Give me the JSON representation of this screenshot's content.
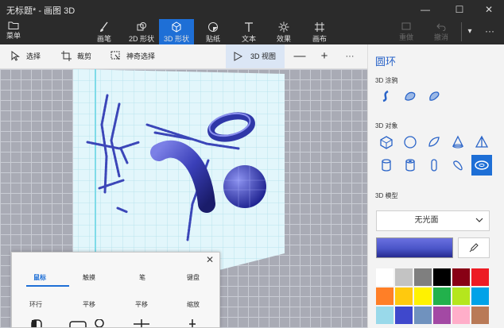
{
  "window": {
    "title": "无标题* - 画图 3D",
    "minimize_glyph": "—",
    "maximize_glyph": "☐",
    "close_glyph": "✕"
  },
  "ribbon": {
    "menu_label": "菜单",
    "tools": [
      {
        "label": "画笔",
        "icon": "brush-icon",
        "active": false
      },
      {
        "label": "2D 形状",
        "icon": "2d-shapes-icon",
        "active": false
      },
      {
        "label": "3D 形状",
        "icon": "3d-shapes-icon",
        "active": true
      },
      {
        "label": "贴纸",
        "icon": "sticker-icon",
        "active": false
      },
      {
        "label": "文本",
        "icon": "text-icon",
        "active": false
      },
      {
        "label": "效果",
        "icon": "effects-icon",
        "active": false
      },
      {
        "label": "画布",
        "icon": "canvas-icon",
        "active": false
      }
    ],
    "undo_label": "撤消",
    "redo_label": "重做",
    "more_glyph": "▾",
    "dots_glyph": "···"
  },
  "toolbar": {
    "select_label": "选择",
    "crop_label": "裁剪",
    "magic_select_label": "神奇选择",
    "view3d_label": "3D 视图",
    "zoom_out_glyph": "—",
    "zoom_in_glyph": "+",
    "more_glyph": "···"
  },
  "panel": {
    "title": "圆环",
    "doodle_label": "3D 涂鸦",
    "objects_label": "3D 对象",
    "models_label": "3D 模型",
    "finish_value": "无光面",
    "selected_color": "#4a55c8",
    "palette": [
      "#ffffff",
      "#c3c3c3",
      "#7f7f7f",
      "#000000",
      "#880015",
      "#ed1c24",
      "#ff7f27",
      "#ffc90e",
      "#fff200",
      "#22b14c",
      "#b5e61d",
      "#00a2e8",
      "#99d9ea",
      "#3f48cc",
      "#7092be",
      "#a349a4",
      "#ffaec9",
      "#b97a57"
    ]
  },
  "help_popup": {
    "tabs": [
      "鼠标",
      "触摸",
      "笔",
      "键盘"
    ],
    "active_tab": 0,
    "gestures": [
      "环行",
      "平移",
      "平移",
      "缩放"
    ],
    "close_glyph": "✕"
  },
  "colors": {
    "accent": "#1e6fd6",
    "dark_bar": "#2b2b2b",
    "canvas_backdrop": "#a9abb5"
  }
}
